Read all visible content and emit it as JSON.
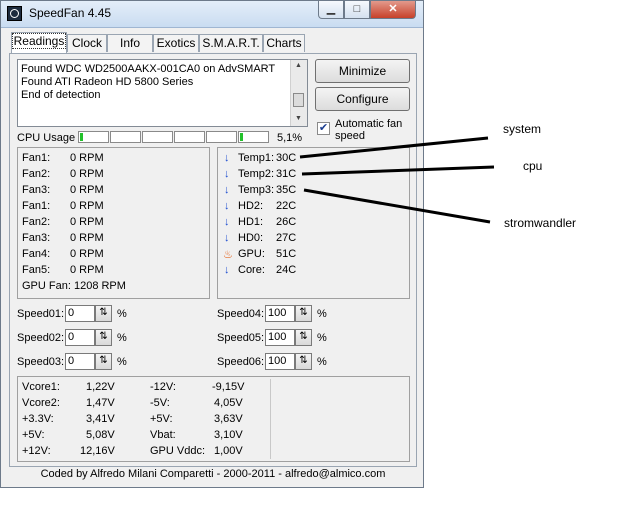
{
  "window": {
    "title": "SpeedFan 4.45",
    "controls": {
      "minimize": "▁",
      "maximize": "□",
      "close": "✕"
    }
  },
  "tabs": [
    "Readings",
    "Clock",
    "Info",
    "Exotics",
    "S.M.A.R.T.",
    "Charts"
  ],
  "log": {
    "lines": [
      "Found WDC WD2500AAKX-001CA0 on AdvSMART",
      "Found ATI Radeon HD 5800 Series",
      "End of detection"
    ]
  },
  "buttons": {
    "minimize": "Minimize",
    "configure": "Configure"
  },
  "auto_fan": {
    "label": "Automatic fan speed",
    "checked": true
  },
  "cpu": {
    "label": "CPU Usage",
    "percent": "5,1%",
    "usage": 5.1
  },
  "fans": [
    {
      "name": "Fan1:",
      "value": "0 RPM"
    },
    {
      "name": "Fan2:",
      "value": "0 RPM"
    },
    {
      "name": "Fan3:",
      "value": "0 RPM"
    },
    {
      "name": "Fan1:",
      "value": "0 RPM"
    },
    {
      "name": "Fan2:",
      "value": "0 RPM"
    },
    {
      "name": "Fan3:",
      "value": "0 RPM"
    },
    {
      "name": "Fan4:",
      "value": "0 RPM"
    },
    {
      "name": "Fan5:",
      "value": "0 RPM"
    }
  ],
  "gpu_fan": "GPU Fan: 1208 RPM",
  "temps": [
    {
      "name": "Temp1:",
      "value": "30C",
      "icon": "down-arrow-icon"
    },
    {
      "name": "Temp2:",
      "value": "31C",
      "icon": "down-arrow-icon"
    },
    {
      "name": "Temp3:",
      "value": "35C",
      "icon": "down-arrow-icon"
    },
    {
      "name": "HD2:",
      "value": "22C",
      "icon": "down-arrow-icon"
    },
    {
      "name": "HD1:",
      "value": "26C",
      "icon": "down-arrow-icon"
    },
    {
      "name": "HD0:",
      "value": "27C",
      "icon": "down-arrow-icon"
    },
    {
      "name": "GPU:",
      "value": "51C",
      "icon": "flame-icon"
    },
    {
      "name": "Core:",
      "value": "24C",
      "icon": "down-arrow-icon"
    }
  ],
  "speeds_left": [
    {
      "name": "Speed01:",
      "value": "0",
      "unit": "%"
    },
    {
      "name": "Speed02:",
      "value": "0",
      "unit": "%"
    },
    {
      "name": "Speed03:",
      "value": "0",
      "unit": "%"
    }
  ],
  "speeds_right": [
    {
      "name": "Speed04:",
      "value": "100",
      "unit": "%"
    },
    {
      "name": "Speed05:",
      "value": "100",
      "unit": "%"
    },
    {
      "name": "Speed06:",
      "value": "100",
      "unit": "%"
    }
  ],
  "voltages_left": [
    {
      "name": "Vcore1:",
      "value": "1,22V"
    },
    {
      "name": "Vcore2:",
      "value": "1,47V"
    },
    {
      "name": "+3.3V:",
      "value": "3,41V"
    },
    {
      "name": "+5V:",
      "value": "5,08V"
    },
    {
      "name": "+12V:",
      "value": "12,16V"
    }
  ],
  "voltages_right": [
    {
      "name": "-12V:",
      "value": "-9,15V"
    },
    {
      "name": "-5V:",
      "value": "4,05V"
    },
    {
      "name": "+5V:",
      "value": "3,63V"
    },
    {
      "name": "Vbat:",
      "value": "3,10V"
    },
    {
      "name": "GPU Vddc:",
      "value": "1,00V"
    }
  ],
  "footer": "Coded by Alfredo Milani Comparetti - 2000-2011 - alfredo@almico.com",
  "annotations": [
    "system",
    "cpu",
    "stromwandler"
  ]
}
